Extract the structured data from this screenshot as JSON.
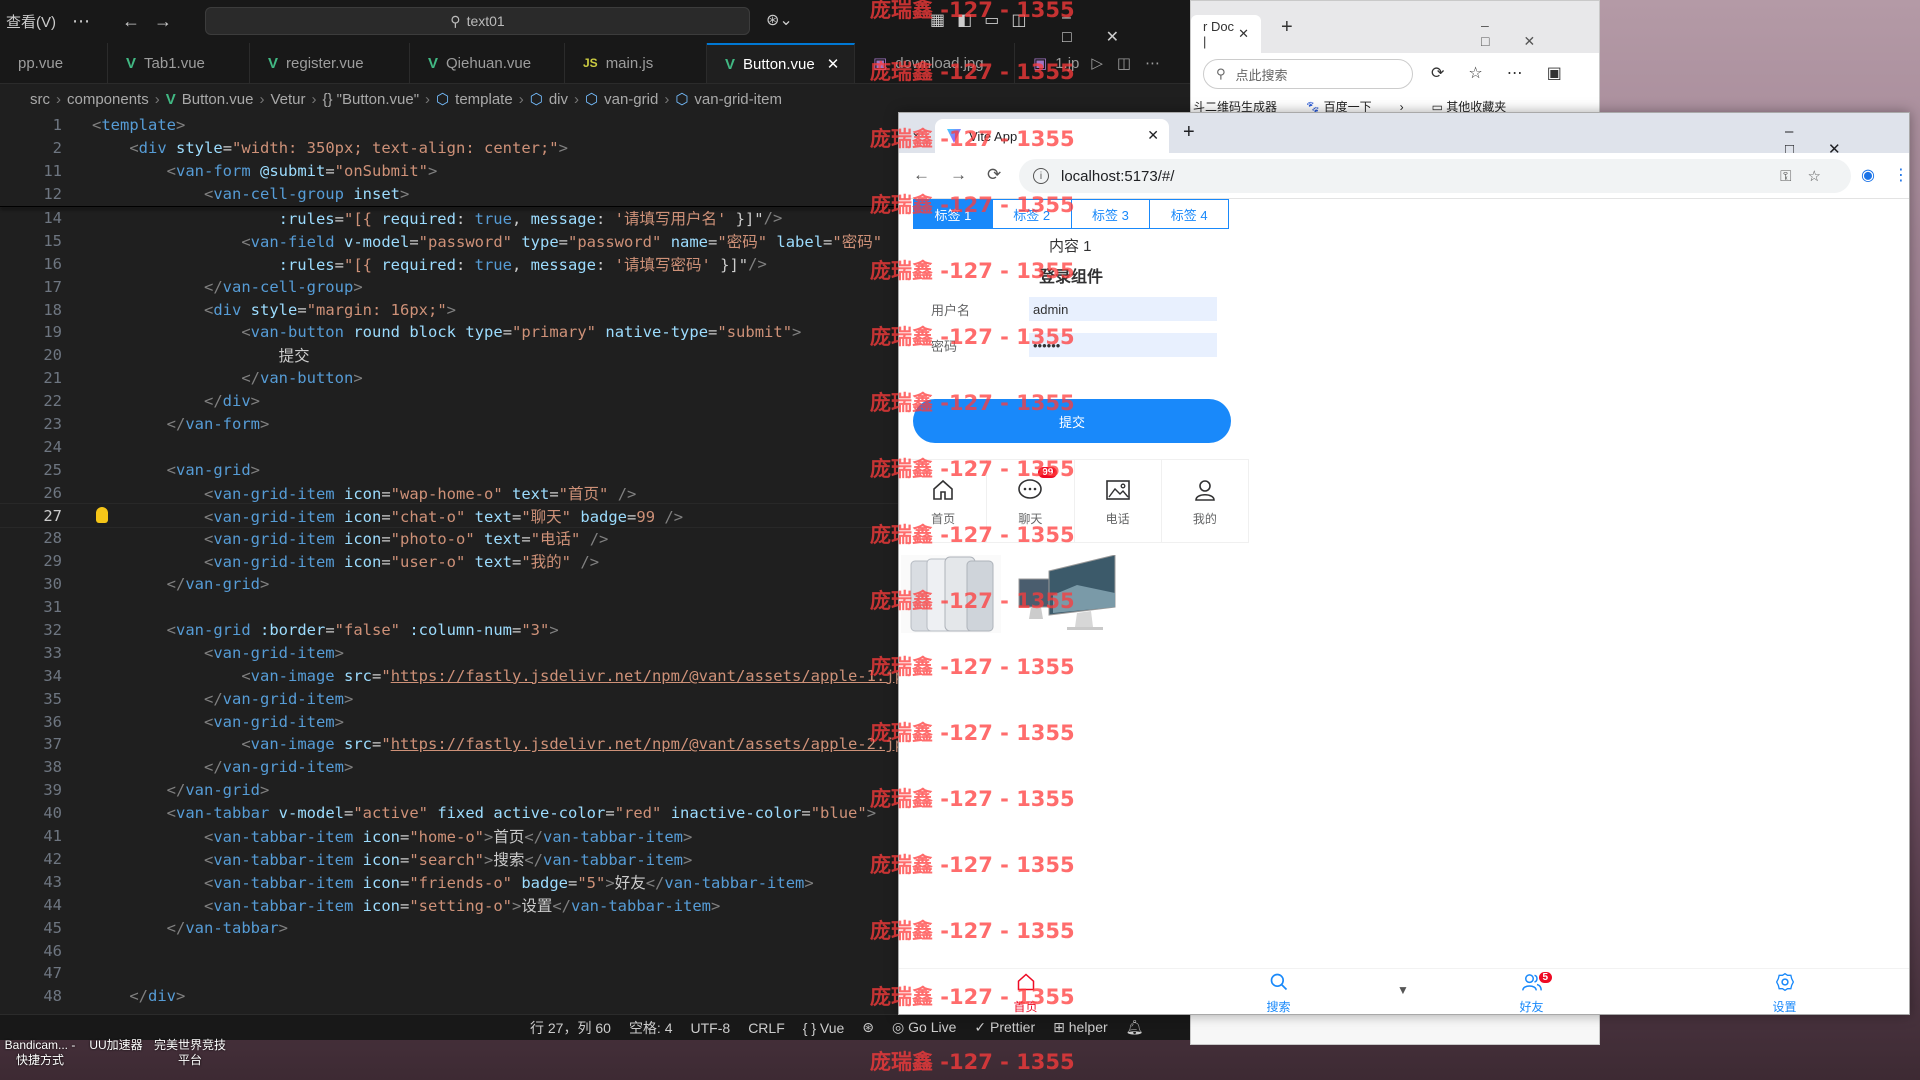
{
  "vscode": {
    "menu": "查看(V)",
    "search": "text01",
    "tabs": [
      {
        "label": "pp.vue",
        "icon": "none"
      },
      {
        "label": "Tab1.vue",
        "icon": "vue"
      },
      {
        "label": "register.vue",
        "icon": "vue"
      },
      {
        "label": "Qiehuan.vue",
        "icon": "vue"
      },
      {
        "label": "main.js",
        "icon": "js"
      },
      {
        "label": "Button.vue",
        "icon": "vue",
        "active": true
      },
      {
        "label": "download.jpg",
        "icon": "img"
      },
      {
        "label": "1.jp",
        "icon": "img"
      }
    ],
    "breadcrumb": [
      "src",
      "components",
      "Button.vue",
      "Vetur",
      "{} \"Button.vue\"",
      "template",
      "div",
      "van-grid",
      "van-grid-item"
    ],
    "status": {
      "position": "行 27，列 60",
      "spaces": "空格: 4",
      "encoding": "UTF-8",
      "eol": "CRLF",
      "language": "Vue",
      "golive": "Go Live",
      "prettier": "Prettier",
      "helper": "helper"
    }
  },
  "edge": {
    "tab_title": "r Doc | ",
    "search_placeholder": "点此搜索",
    "favorites": [
      "斗二维码生成器",
      "百度一下",
      "其他收藏夹"
    ]
  },
  "chrome": {
    "tab_title": "Vite App",
    "url": "localhost:5173/#/"
  },
  "app": {
    "tabs": [
      "标签 1",
      "标签 2",
      "标签 3",
      "标签 4"
    ],
    "active_tab": 0,
    "tab_content": "内容 1",
    "form_title": "登录组件",
    "username_label": "用户名",
    "username_value": "admin",
    "password_label": "密码",
    "password_value": "••••••",
    "submit_label": "提交",
    "grid": [
      {
        "label": "首页",
        "icon": "home-icon"
      },
      {
        "label": "聊天",
        "icon": "chat-icon",
        "badge": "99"
      },
      {
        "label": "电话",
        "icon": "photo-icon"
      },
      {
        "label": "我的",
        "icon": "user-icon"
      }
    ],
    "tabbar": [
      {
        "label": "首页",
        "icon": "home-icon",
        "active": true
      },
      {
        "label": "搜索",
        "icon": "search-icon"
      },
      {
        "label": "好友",
        "icon": "friends-icon",
        "badge": "5"
      },
      {
        "label": "设置",
        "icon": "setting-icon"
      }
    ],
    "active_color": "#ee0a24",
    "inactive_color": "#1989fa"
  },
  "watermark": "庞瑞鑫 -127 - 1355",
  "taskbar": [
    {
      "label": "Bandicam... - 快捷方式"
    },
    {
      "label": "UU加速器"
    },
    {
      "label": "完美世界竞技平台"
    }
  ]
}
